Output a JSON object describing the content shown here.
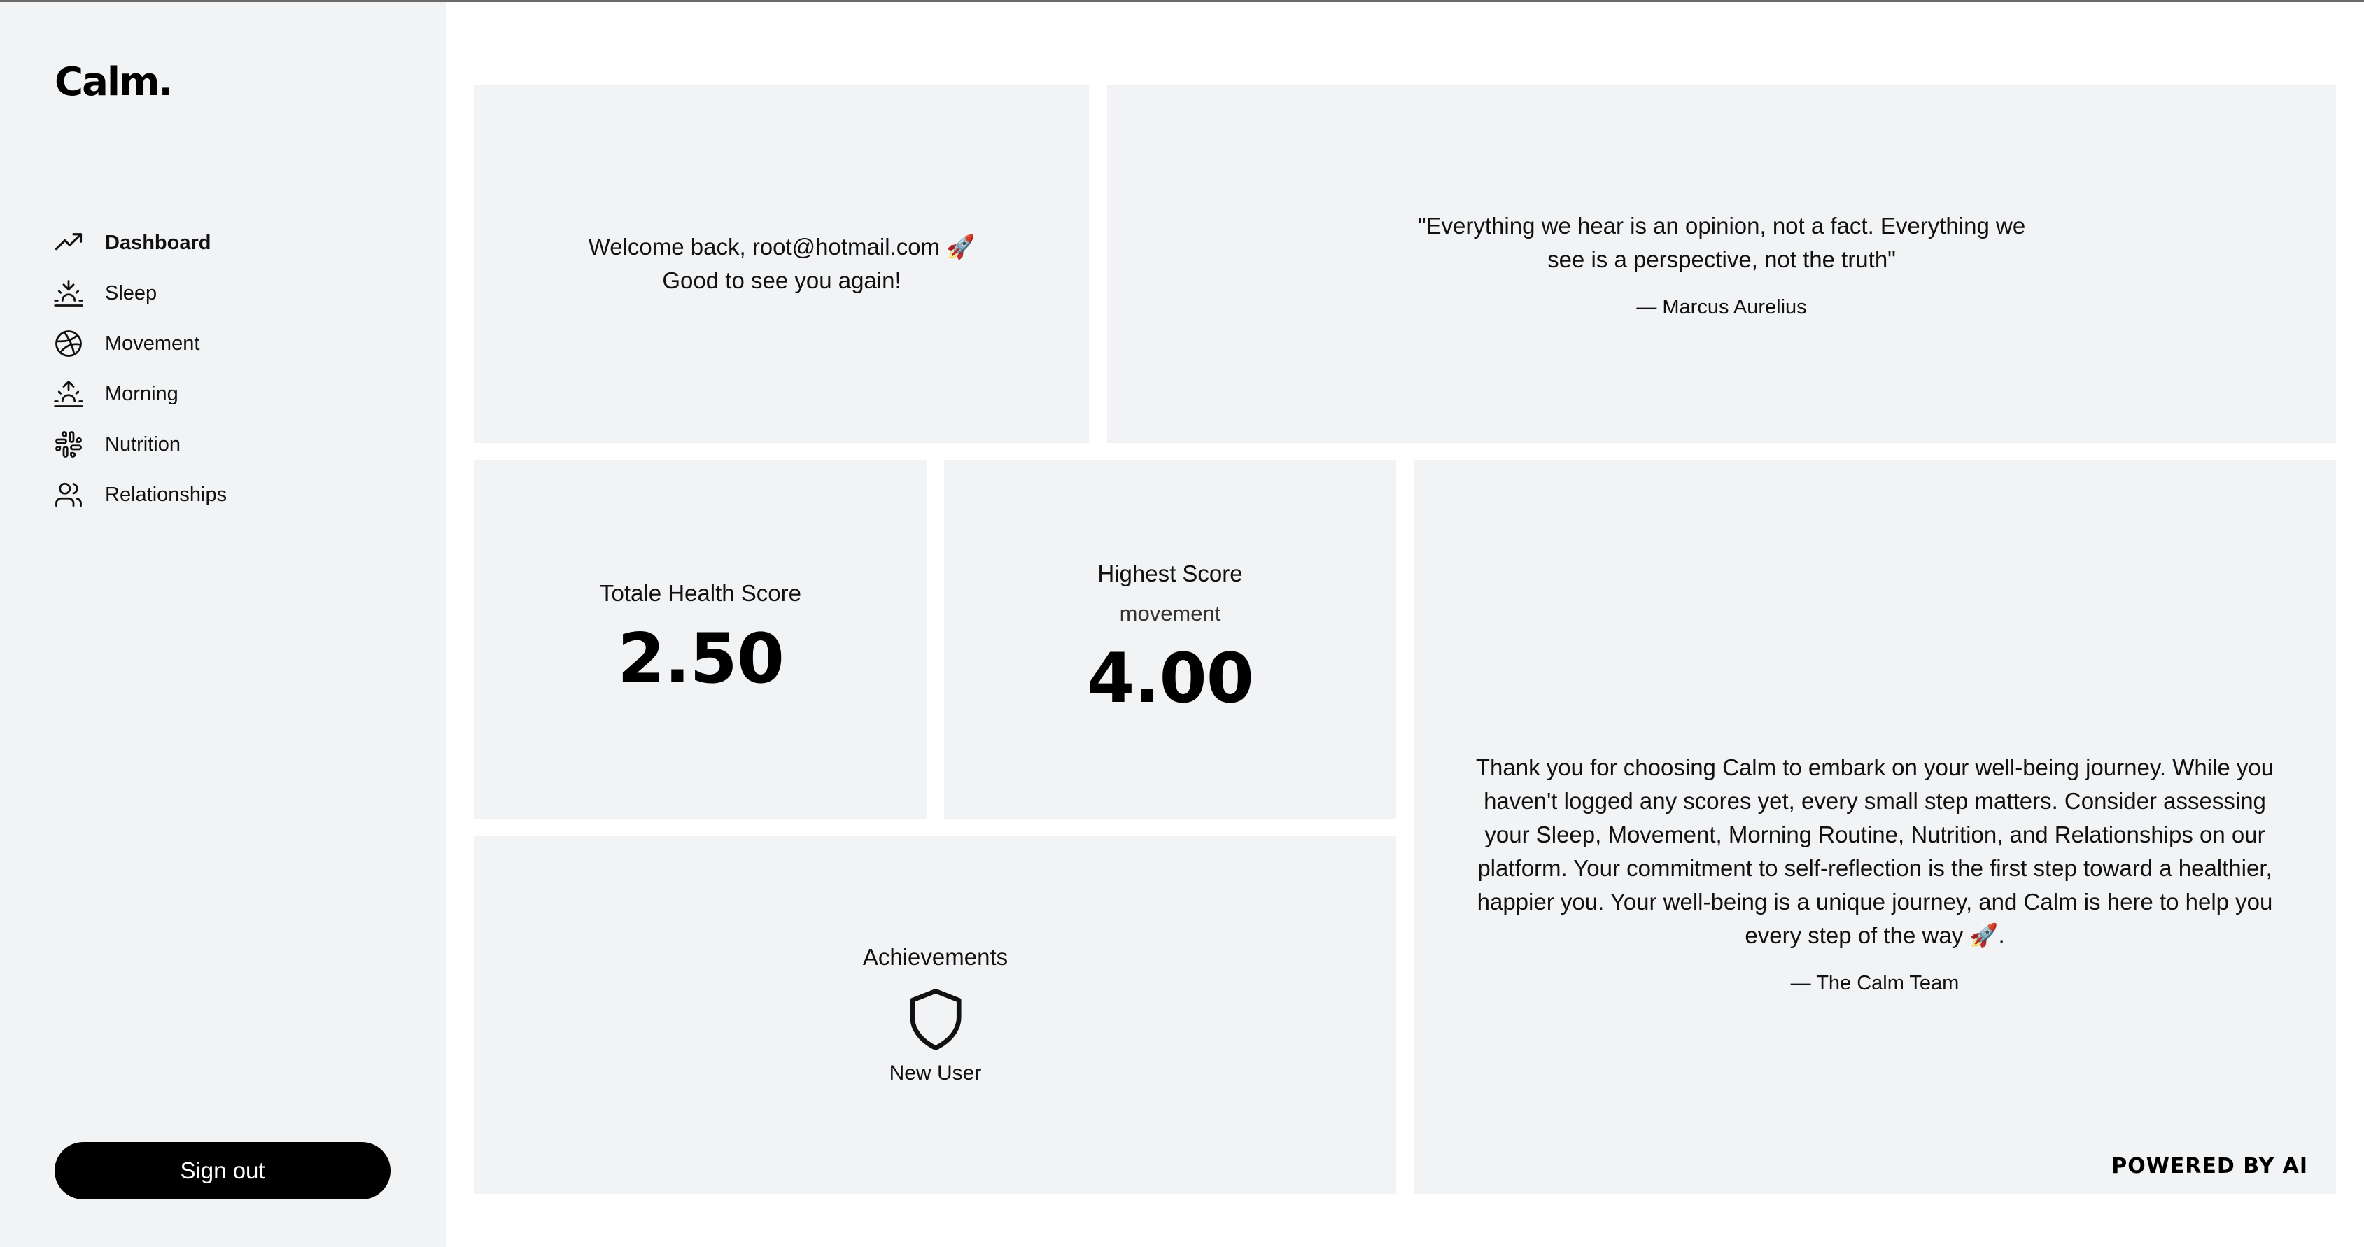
{
  "brand": {
    "logo": "Calm."
  },
  "sidebar": {
    "items": [
      {
        "label": "Dashboard",
        "icon": "trending-up-icon",
        "active": true
      },
      {
        "label": "Sleep",
        "icon": "sunset-icon",
        "active": false
      },
      {
        "label": "Movement",
        "icon": "dribbble-ball-icon",
        "active": false
      },
      {
        "label": "Morning",
        "icon": "sunrise-icon",
        "active": false
      },
      {
        "label": "Nutrition",
        "icon": "slack-grid-icon",
        "active": false
      },
      {
        "label": "Relationships",
        "icon": "users-icon",
        "active": false
      }
    ],
    "signout_label": "Sign out"
  },
  "welcome": {
    "line1": "Welcome back, root@hotmail.com 🚀",
    "line2": "Good to see you again!"
  },
  "quote": {
    "text": "\"Everything we hear is an opinion, not a fact. Everything we see is a perspective, not the truth\"",
    "author": "— Marcus Aurelius"
  },
  "total_score": {
    "label": "Totale Health Score",
    "value": "2.50"
  },
  "highest_score": {
    "label": "Highest Score",
    "category": "movement",
    "value": "4.00"
  },
  "achievements": {
    "title": "Achievements",
    "badge_icon": "shield-icon",
    "badge_label": "New User"
  },
  "message": {
    "text": "Thank you for choosing Calm to embark on your well-being journey. While you haven't logged any scores yet, every small step matters. Consider assessing your Sleep, Movement, Morning Routine, Nutrition, and Relationships on our platform. Your commitment to self-reflection is the first step toward a healthier, happier you. Your well-being is a unique journey, and Calm is here to help you every step of the way 🚀.",
    "author": "— The Calm Team",
    "powered_by": "POWERED BY AI"
  },
  "colors": {
    "card_background": "#f2f3f5",
    "accent": "#000000",
    "text": "#111111"
  }
}
